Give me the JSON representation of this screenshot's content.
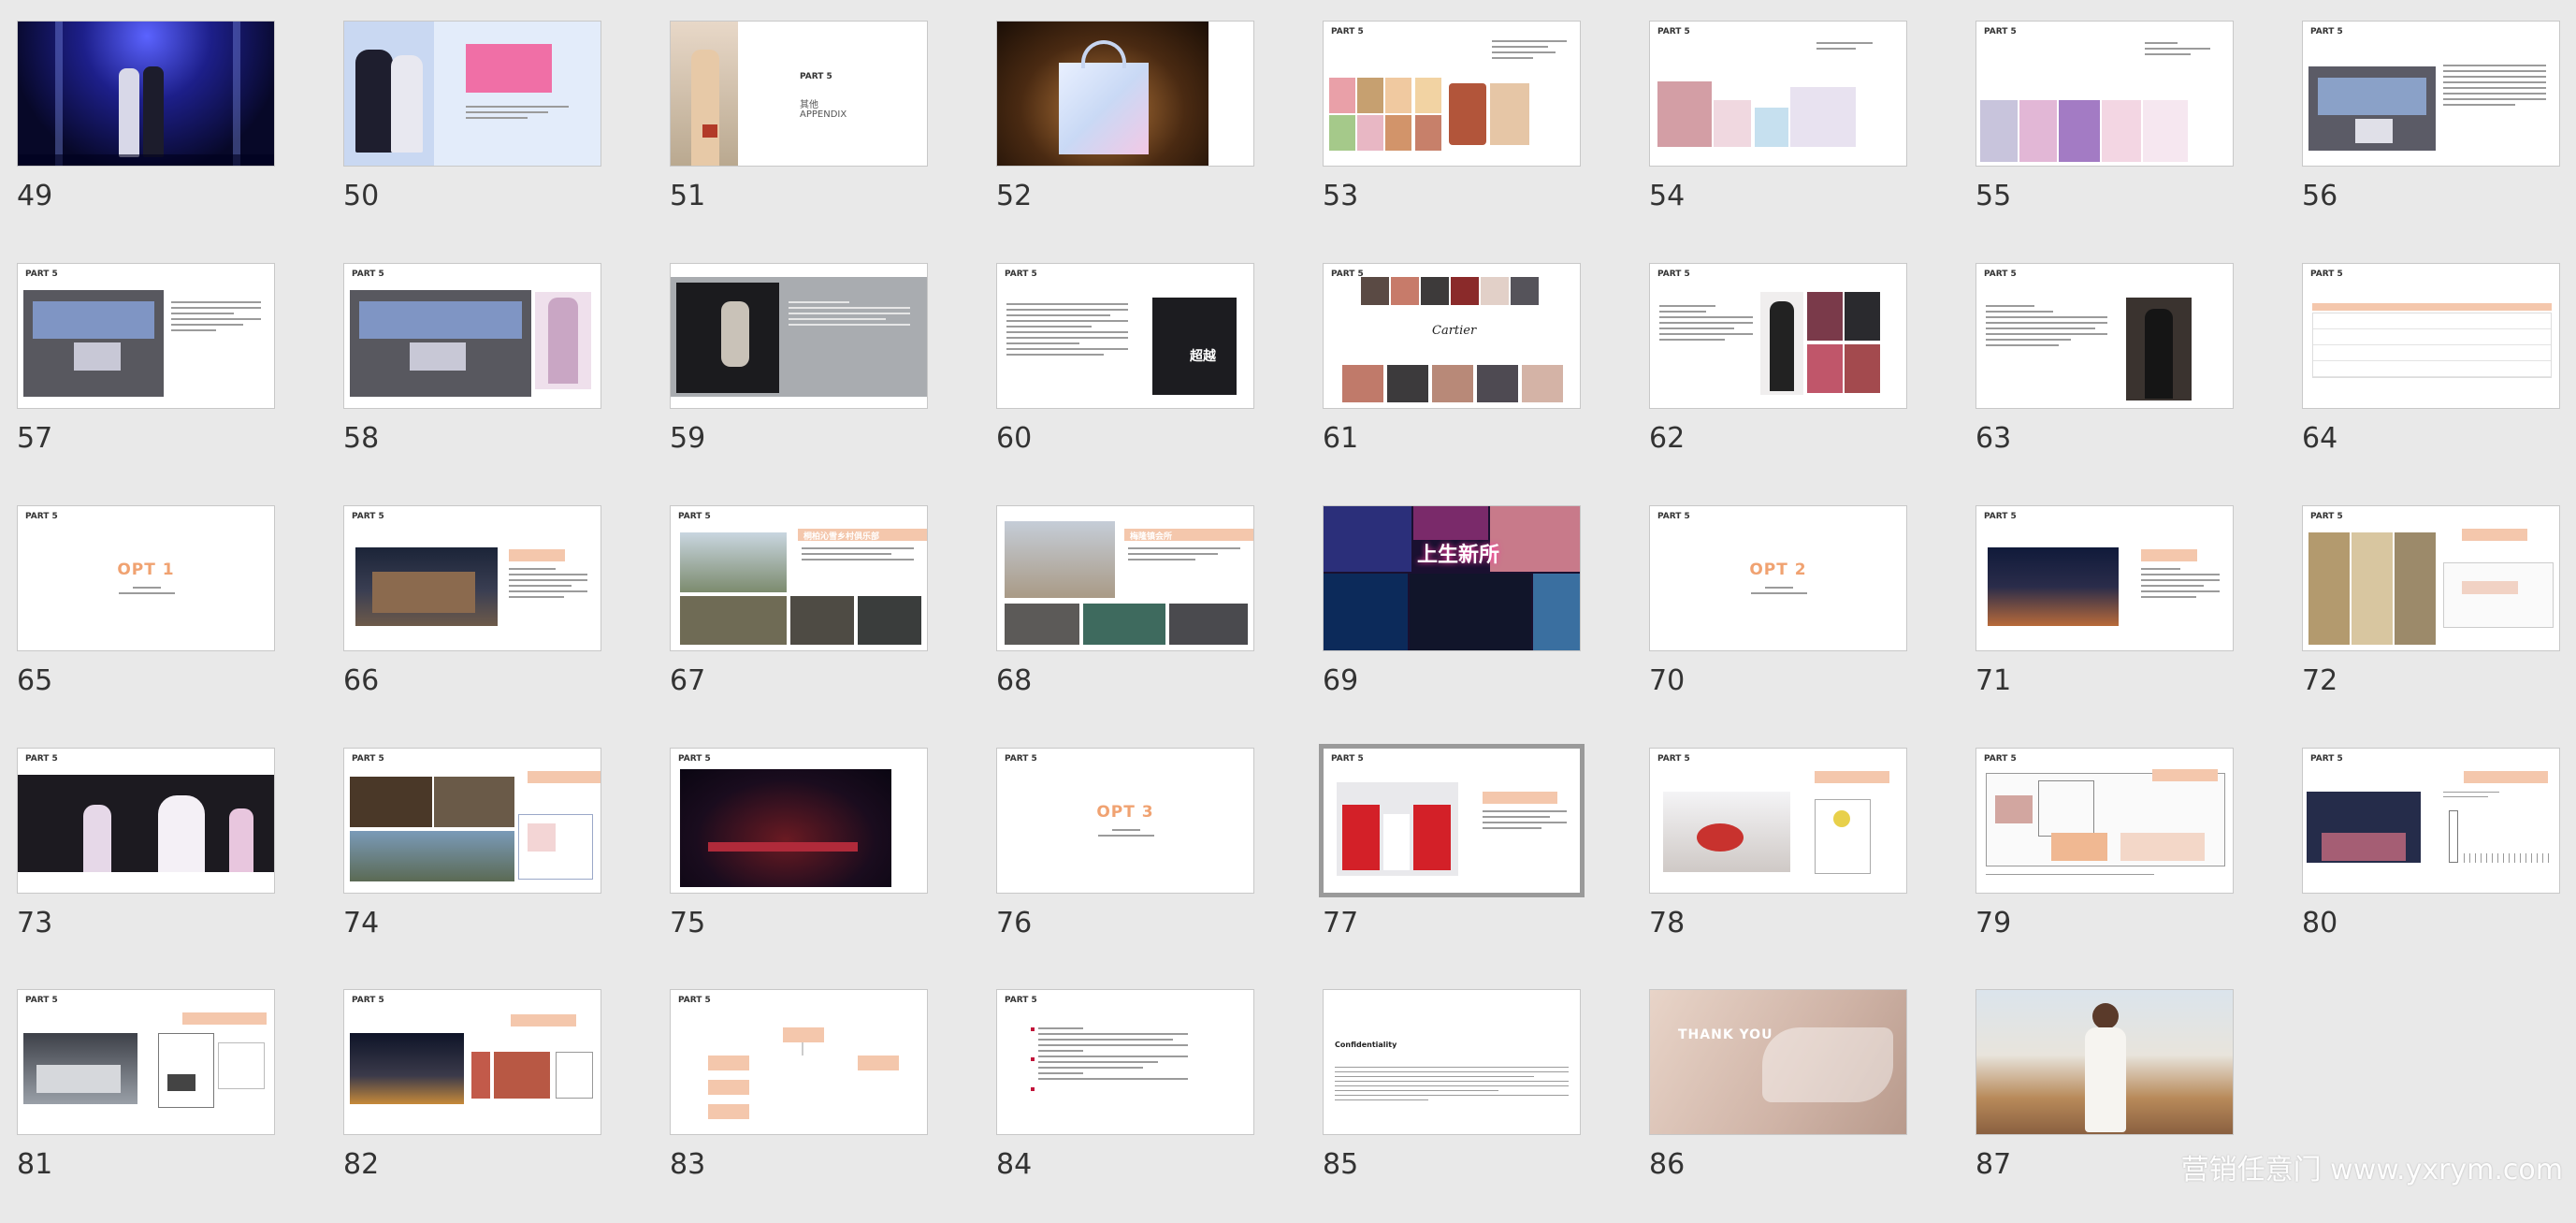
{
  "slides": [
    {
      "number": "49"
    },
    {
      "number": "50"
    },
    {
      "number": "51"
    },
    {
      "number": "52"
    },
    {
      "number": "53"
    },
    {
      "number": "54"
    },
    {
      "number": "55"
    },
    {
      "number": "56"
    },
    {
      "number": "57"
    },
    {
      "number": "58"
    },
    {
      "number": "59"
    },
    {
      "number": "60"
    },
    {
      "number": "61"
    },
    {
      "number": "62"
    },
    {
      "number": "63"
    },
    {
      "number": "64"
    },
    {
      "number": "65"
    },
    {
      "number": "66"
    },
    {
      "number": "67"
    },
    {
      "number": "68"
    },
    {
      "number": "69"
    },
    {
      "number": "70"
    },
    {
      "number": "71"
    },
    {
      "number": "72"
    },
    {
      "number": "73"
    },
    {
      "number": "74"
    },
    {
      "number": "75"
    },
    {
      "number": "76"
    },
    {
      "number": "77"
    },
    {
      "number": "78"
    },
    {
      "number": "79"
    },
    {
      "number": "80"
    },
    {
      "number": "81"
    },
    {
      "number": "82"
    },
    {
      "number": "83"
    },
    {
      "number": "84"
    },
    {
      "number": "85"
    },
    {
      "number": "86"
    },
    {
      "number": "87"
    }
  ],
  "selected_slide": "77",
  "text": {
    "part": "PART 5",
    "appendix_title": "其他",
    "appendix_sub": "APPENDIX",
    "opt1": "OPT 1",
    "opt2": "OPT 2",
    "opt3": "OPT 3",
    "thank_you": "THANK YOU",
    "confidentiality": "Confidentiality",
    "brand_cartier": "Cartier",
    "neon_sign": "上生新所",
    "venue_67": "桐柏沁雪乡村俱乐部",
    "venue_68": "梅隆镇会所",
    "name_60": "超越"
  },
  "watermark": "营销任意门 www.yxrym.com",
  "colors": {
    "background": "#e9e9e9",
    "accent_peach": "#f4c7ac",
    "opt_orange": "#f0a271",
    "selected_border": "#9a9a9a"
  }
}
